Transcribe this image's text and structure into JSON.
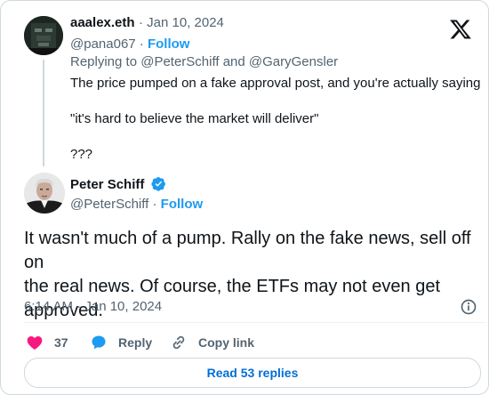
{
  "reply": {
    "name": "aaalex.eth",
    "date": "· Jan 10, 2024",
    "handle": "@pana067",
    "follow_sep": " · ",
    "follow": "Follow",
    "replying_to": "Replying to @PeterSchiff and @GaryGensler",
    "lines": [
      "The price pumped on a fake approval post, and you're actually saying",
      "\"it's hard to believe the market will deliver\"",
      "???"
    ]
  },
  "tweet": {
    "name": "Peter Schiff",
    "handle": "@PeterSchiff",
    "follow_sep": " · ",
    "follow": "Follow",
    "lines": [
      "It wasn't much of a pump. Rally on the fake news, sell off on",
      "the real news.  Of course, the ETFs may not even get",
      "approved."
    ],
    "timestamp": "6:14 AM · Jan 10, 2024"
  },
  "actions": {
    "likes": "37",
    "reply_label": "Reply",
    "copy_label": "Copy link"
  },
  "read_replies": "Read 53 replies",
  "colors": {
    "accent": "#1d9bf0",
    "like": "#f91880",
    "muted": "#536471"
  },
  "icons": [
    "x-logo-icon",
    "verified-badge-icon",
    "info-icon",
    "heart-icon",
    "reply-bubble-icon",
    "link-icon"
  ]
}
